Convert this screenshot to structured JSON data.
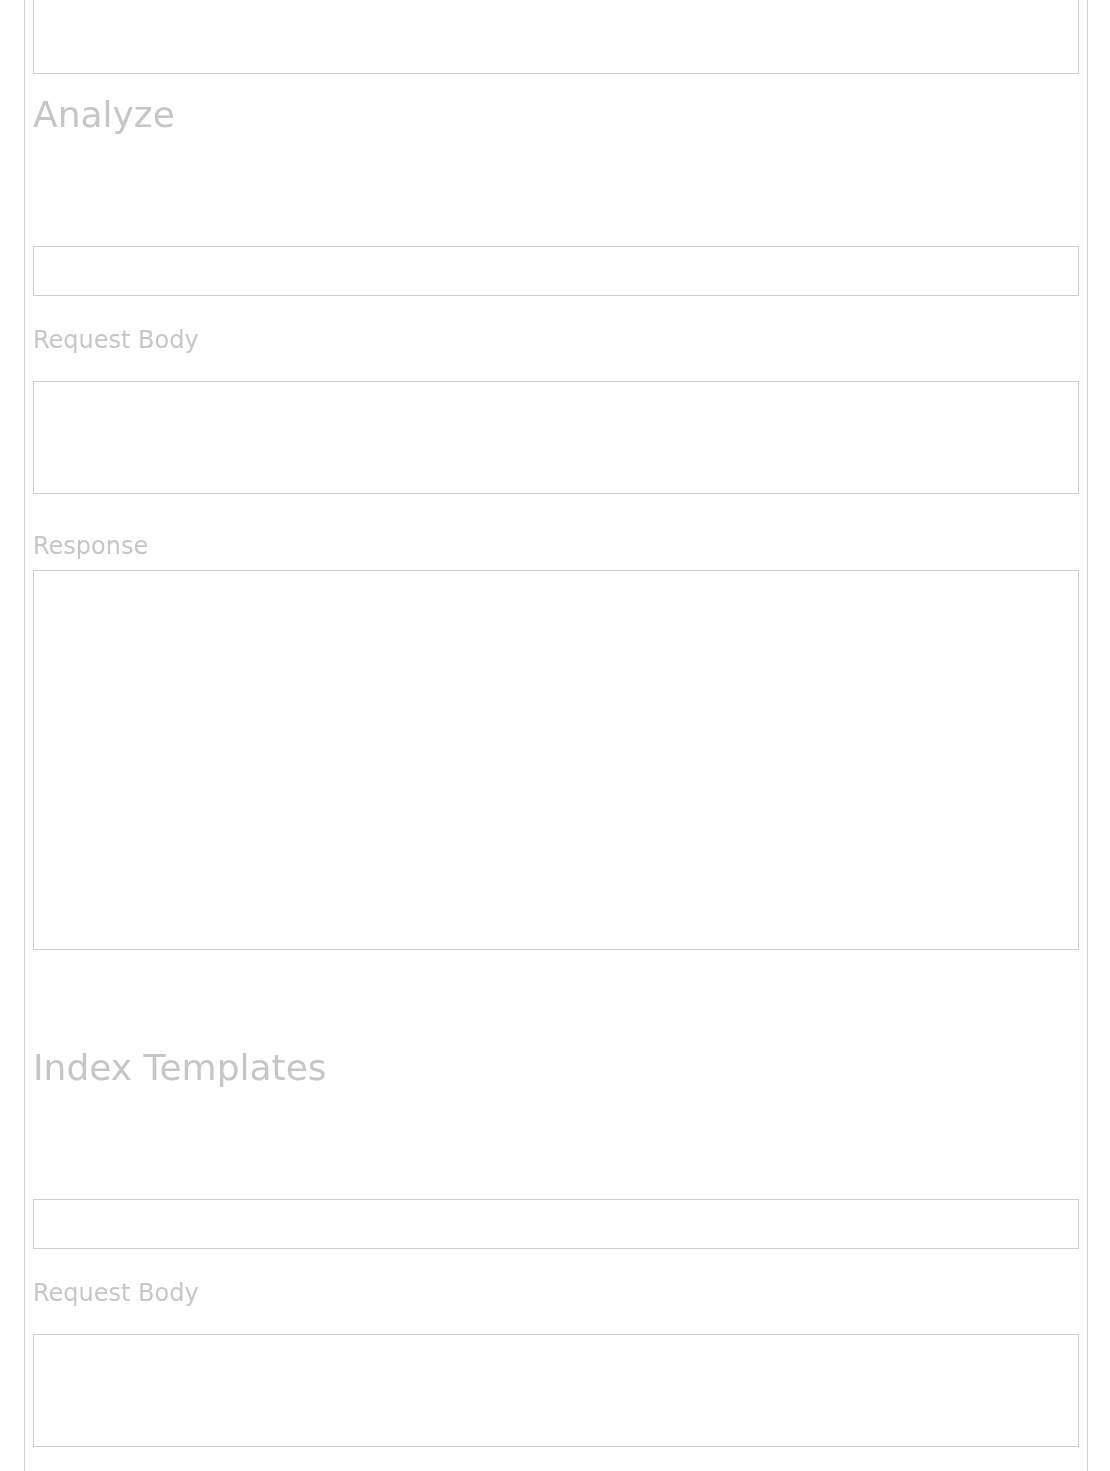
{
  "sections": [
    {
      "heading": "Analyze",
      "request_body_label": "Request Body",
      "response_label": "Response"
    },
    {
      "heading": "Index Templates",
      "request_body_label": "Request Body"
    }
  ]
}
